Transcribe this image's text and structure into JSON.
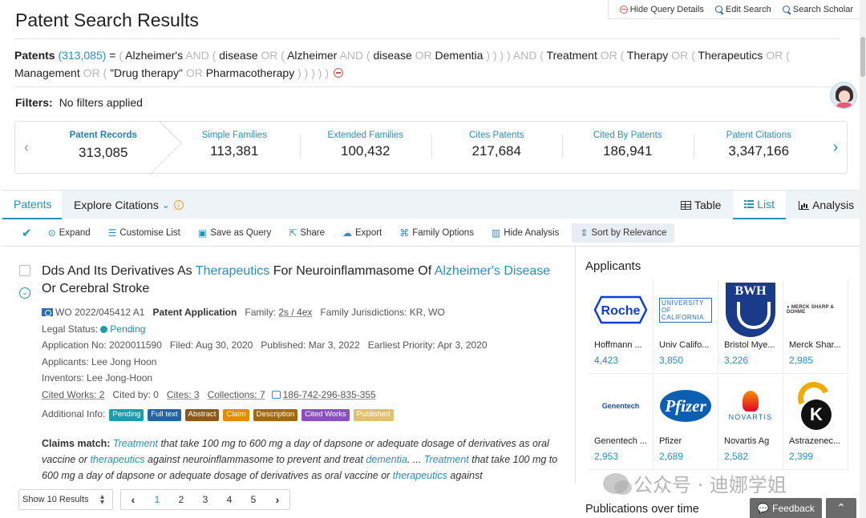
{
  "header": {
    "title": "Patent Search Results",
    "links": {
      "hide_query": "Hide Query Details",
      "edit_search": "Edit Search",
      "search_scholar": "Search Scholar"
    }
  },
  "query": {
    "label": "Patents",
    "count": "(313,085)",
    "eq": "=",
    "tokens": [
      {
        "t": "(",
        "k": "par"
      },
      {
        "t": "Alzheimer's",
        "k": "term"
      },
      {
        "t": "AND",
        "k": "op"
      },
      {
        "t": "(",
        "k": "par"
      },
      {
        "t": "disease",
        "k": "term"
      },
      {
        "t": "OR",
        "k": "op"
      },
      {
        "t": "(",
        "k": "par"
      },
      {
        "t": "Alzheimer",
        "k": "term"
      },
      {
        "t": "AND",
        "k": "op"
      },
      {
        "t": "(",
        "k": "par"
      },
      {
        "t": "disease",
        "k": "term"
      },
      {
        "t": "OR",
        "k": "op"
      },
      {
        "t": "Dementia",
        "k": "term"
      },
      {
        "t": ") ) ) )",
        "k": "par"
      },
      {
        "t": "AND",
        "k": "op"
      },
      {
        "t": "(",
        "k": "par"
      },
      {
        "t": "Treatment",
        "k": "term"
      },
      {
        "t": "OR",
        "k": "op"
      },
      {
        "t": "(",
        "k": "par"
      },
      {
        "t": "Therapy",
        "k": "term"
      },
      {
        "t": "OR",
        "k": "op"
      },
      {
        "t": "(",
        "k": "par"
      },
      {
        "t": "Therapeutics",
        "k": "term"
      },
      {
        "t": "OR",
        "k": "op"
      },
      {
        "t": "(",
        "k": "par"
      },
      {
        "t": "Management",
        "k": "term"
      },
      {
        "t": "OR",
        "k": "op"
      },
      {
        "t": "(",
        "k": "par"
      },
      {
        "t": "\"Drug therapy\"",
        "k": "term"
      },
      {
        "t": "OR",
        "k": "op"
      },
      {
        "t": "Pharmacotherapy",
        "k": "term"
      },
      {
        "t": ") ) ) ) )",
        "k": "par"
      }
    ]
  },
  "filters": {
    "label": "Filters:",
    "value": "No filters applied"
  },
  "stats": [
    {
      "label": "Patent Records",
      "value": "313,085"
    },
    {
      "label": "Simple Families",
      "value": "113,381"
    },
    {
      "label": "Extended Families",
      "value": "100,432"
    },
    {
      "label": "Cites Patents",
      "value": "217,684"
    },
    {
      "label": "Cited By Patents",
      "value": "186,941"
    },
    {
      "label": "Patent Citations",
      "value": "3,347,166"
    }
  ],
  "tabs": {
    "patents": "Patents",
    "explore": "Explore Citations",
    "table": "Table",
    "list": "List",
    "analysis": "Analysis"
  },
  "toolbar": {
    "expand": "Expand",
    "customise": "Customise List",
    "save_query": "Save as Query",
    "share": "Share",
    "export": "Export",
    "family": "Family Options",
    "hide_analysis": "Hide Analysis",
    "sort": "Sort by Relevance"
  },
  "result": {
    "title_parts": [
      {
        "t": "Dds And Its Derivatives As ",
        "hl": false
      },
      {
        "t": "Therapeutics",
        "hl": true
      },
      {
        "t": " For Neuroinflammasome Of ",
        "hl": false
      },
      {
        "t": "Alzheimer's",
        "hl": true
      },
      {
        "t": " ",
        "hl": false
      },
      {
        "t": "Disease",
        "hl": true
      },
      {
        "t": " Or Cerebral Stroke",
        "hl": false
      }
    ],
    "pub_no": "WO 2022/045412 A1",
    "doc_type": "Patent Application",
    "family_label": "Family:",
    "family": "2s / 4ex",
    "jurisdictions": "Family Jurisdictions: KR, WO",
    "legal_label": "Legal Status:",
    "legal_status": "Pending",
    "app_no": "Application No: 2020011590",
    "filed": "Filed: Aug 30, 2020",
    "published": "Published: Mar 3, 2022",
    "priority": "Earliest Priority: Apr 3, 2020",
    "applicants": "Applicants: Lee Jong Hoon",
    "inventors": "Inventors: Lee Jong-Hoon",
    "cited_works": "Cited Works: 2",
    "cited_by": "Cited by: 0",
    "cites": "Cites: 3",
    "collections": "Collections: 7",
    "lens_id": "186-742-296-835-355",
    "additional_label": "Additional Info:",
    "tags": [
      {
        "label": "Pending",
        "color": "#1a9fa8"
      },
      {
        "label": "Full text",
        "color": "#2563a8"
      },
      {
        "label": "Abstract",
        "color": "#8a5a1a"
      },
      {
        "label": "Claim",
        "color": "#e68a00"
      },
      {
        "label": "Description",
        "color": "#a06a10"
      },
      {
        "label": "Cited Works",
        "color": "#8a4fc0"
      },
      {
        "label": "Published",
        "color": "#e0c070"
      }
    ],
    "claims_label": "Claims match:",
    "claims_parts": [
      {
        "t": "Treatment",
        "hl": true
      },
      {
        "t": " that take 100 mg to 600 mg a day of dapsone or adequate dosage of derivatives as oral vaccine or ",
        "hl": false
      },
      {
        "t": "therapeutics",
        "hl": true
      },
      {
        "t": " against neuroinflammasome to prevent and treat ",
        "hl": false
      },
      {
        "t": "dementia",
        "hl": true
      },
      {
        "t": ". ... ",
        "hl": false
      },
      {
        "t": "Treatment",
        "hl": true
      },
      {
        "t": " that take 100 mg to 600 mg a day of dapsone or adequate dosage of derivatives as oral vaccine or ",
        "hl": false
      },
      {
        "t": "therapeutics",
        "hl": true
      },
      {
        "t": " against",
        "hl": false
      }
    ]
  },
  "pager": {
    "show": "Show 10 Results",
    "pages": [
      "1",
      "2",
      "3",
      "4",
      "5"
    ],
    "active": "1"
  },
  "applicants": {
    "title": "Applicants",
    "items": [
      {
        "name": "Hoffmann ...",
        "count": "4,423",
        "logo": "roche-logo"
      },
      {
        "name": "Univ Califo...",
        "count": "3,850",
        "logo": "uc-logo"
      },
      {
        "name": "Bristol Mye...",
        "count": "3,226",
        "logo": "bwh-logo"
      },
      {
        "name": "Merck Shar...",
        "count": "2,985",
        "logo": "merck-logo"
      },
      {
        "name": "Genentech ...",
        "count": "2,953",
        "logo": "genentech-logo"
      },
      {
        "name": "Pfizer",
        "count": "2,689",
        "logo": "pfizer-logo"
      },
      {
        "name": "Novartis Ag",
        "count": "2,582",
        "logo": "novartis-logo"
      },
      {
        "name": "Astrazenec...",
        "count": "2,399",
        "logo": "astrazeneca-logo"
      }
    ],
    "logo_text": {
      "roche": "Roche",
      "uc": "UNIVERSITY OF CALIFORNIA",
      "bwh": "BWH",
      "merck": "MERCK SHARP & DOHME",
      "genentech": "Genentech",
      "pfizer": "Pfizer",
      "novartis": "NOVARTIS",
      "az": "K"
    }
  },
  "publications_title": "Publications over time",
  "watermark": "公众号 · 迪娜学姐",
  "feedback": "Feedback",
  "colors": {
    "accent": "#2a8fbd",
    "danger": "#d9534f"
  }
}
